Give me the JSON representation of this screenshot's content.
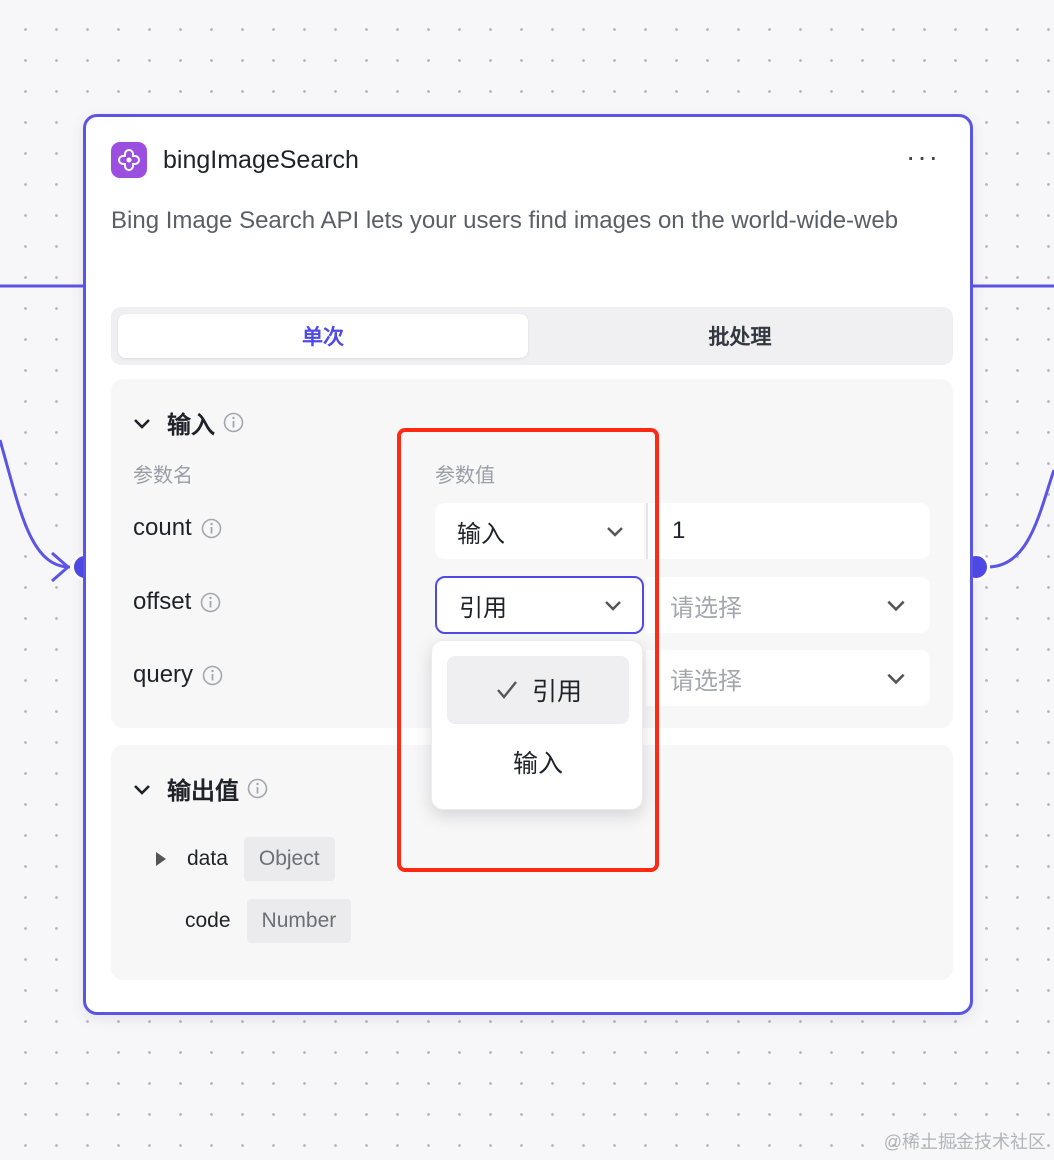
{
  "node": {
    "title": "bingImageSearch",
    "more_label": "···",
    "description": "Bing Image Search API lets your users find images on the world-wide-web"
  },
  "tabs": [
    {
      "label": "单次",
      "active": true
    },
    {
      "label": "批处理",
      "active": false
    }
  ],
  "input_section": {
    "title": "输入",
    "col_name": "参数名",
    "col_value": "参数值",
    "params": [
      {
        "name": "count",
        "mode": "输入",
        "value": "1"
      },
      {
        "name": "offset",
        "mode": "引用",
        "value": "请选择"
      },
      {
        "name": "query",
        "mode": "",
        "value": "请选择"
      }
    ]
  },
  "dropdown": {
    "options": [
      {
        "label": "引用",
        "selected": true
      },
      {
        "label": "输入",
        "selected": false
      }
    ]
  },
  "output_section": {
    "title": "输出值",
    "fields": [
      {
        "name": "data",
        "type": "Object",
        "expandable": true
      },
      {
        "name": "code",
        "type": "Number",
        "expandable": false
      }
    ]
  },
  "colors": {
    "accent": "#4f4ae6",
    "highlight": "#ff2a14",
    "app_icon": "#9b4fe0"
  },
  "watermark": "@稀土掘金技术社区"
}
